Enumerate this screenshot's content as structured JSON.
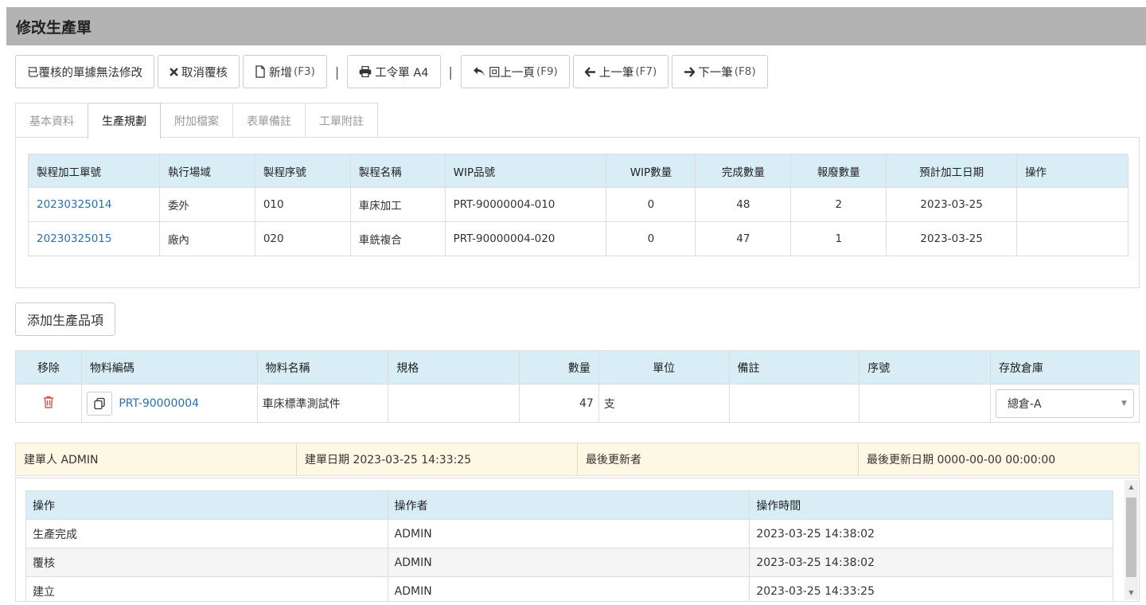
{
  "page_title": "修改生產單",
  "toolbar": {
    "locked_label": "已覆核的單據無法修改",
    "cancel_review_label": "取消覆核",
    "new_label": "新增",
    "new_key": "(F3)",
    "work_order_label": "工令單 A4",
    "back_label": "回上一頁",
    "back_key": "(F9)",
    "prev_label": "上一筆",
    "prev_key": "(F7)",
    "next_label": "下一筆",
    "next_key": "(F8)",
    "separator": "|"
  },
  "tabs": [
    "基本資料",
    "生產規劃",
    "附加檔案",
    "表單備註",
    "工單附註"
  ],
  "process_table": {
    "headers": [
      "製程加工單號",
      "執行場域",
      "製程序號",
      "製程名稱",
      "WIP品號",
      "WIP數量",
      "完成數量",
      "報廢數量",
      "預計加工日期",
      "操作"
    ],
    "rows": [
      [
        "20230325014",
        "委外",
        "010",
        "車床加工",
        "PRT-90000004-010",
        "0",
        "48",
        "2",
        "2023-03-25",
        ""
      ],
      [
        "20230325015",
        "廠內",
        "020",
        "車銑複合",
        "PRT-90000004-020",
        "0",
        "47",
        "1",
        "2023-03-25",
        ""
      ]
    ]
  },
  "add_item_label": "添加生產品項",
  "item_table": {
    "headers": [
      "移除",
      "物料編碼",
      "物料名稱",
      "規格",
      "數量",
      "單位",
      "備註",
      "序號",
      "存放倉庫"
    ],
    "row": {
      "code": "PRT-90000004",
      "name": "車床標準測試件",
      "spec": "",
      "qty": "47",
      "unit": "支",
      "note": "",
      "serial": "",
      "warehouse": "總倉-A"
    }
  },
  "info_bar": {
    "creator": "建單人 ADMIN",
    "created_date": "建單日期 2023-03-25 14:33:25",
    "last_updater": "最後更新者",
    "last_update_date": "最後更新日期 0000-00-00 00:00:00"
  },
  "log_table": {
    "headers": [
      "操作",
      "操作者",
      "操作時間"
    ],
    "rows": [
      [
        "生產完成",
        "ADMIN",
        "2023-03-25 14:38:02"
      ],
      [
        "覆核",
        "ADMIN",
        "2023-03-25 14:38:02"
      ],
      [
        "建立",
        "ADMIN",
        "2023-03-25 14:33:25"
      ]
    ]
  },
  "colors": {
    "title_bar": "#b3b3b3",
    "table_header": "#d9edf7",
    "link": "#2a6fb3",
    "trash": "#d9534f",
    "info_bar": "#fcf8e3"
  }
}
